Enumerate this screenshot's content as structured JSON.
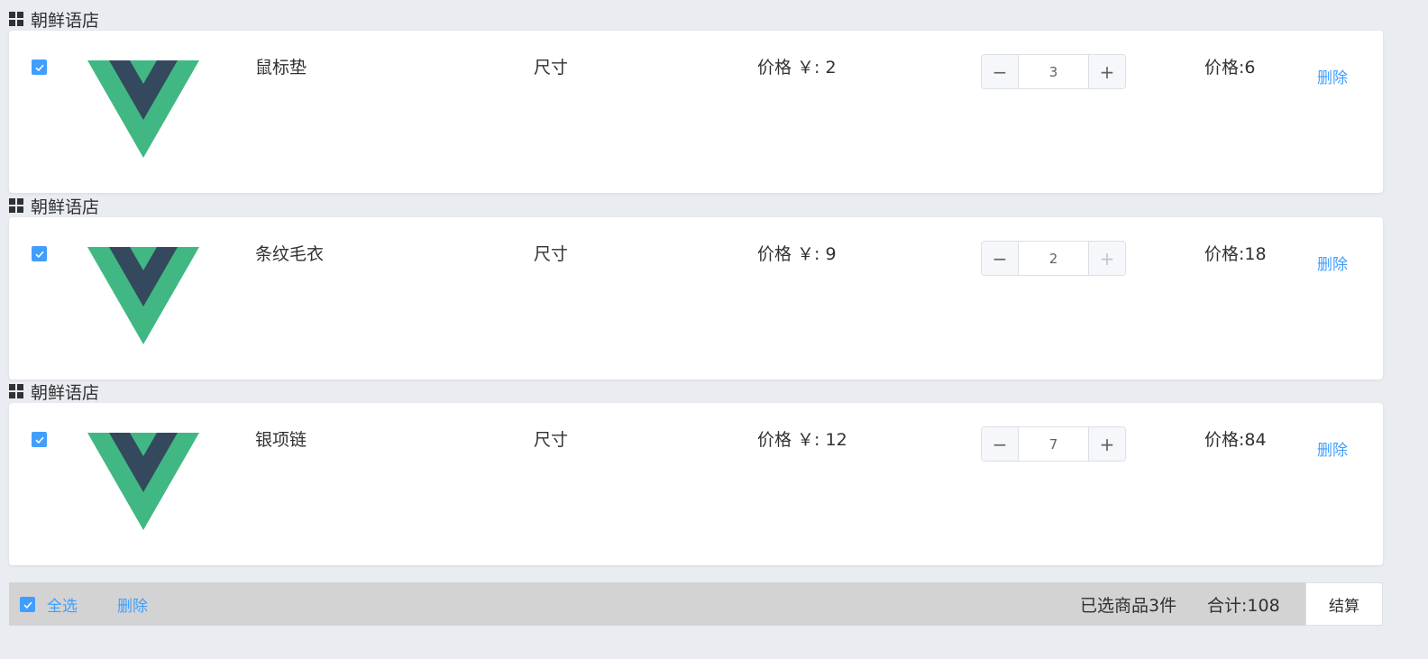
{
  "shops": [
    {
      "shop_name": "朝鲜语店",
      "item": {
        "checked": true,
        "name": "鼠标垫",
        "spec_label": "尺寸",
        "unit_price": "价格 ￥: 2",
        "quantity": "3",
        "minus_label": "−",
        "plus_label": "+",
        "subtotal": "价格:6",
        "delete_label": "删除"
      }
    },
    {
      "shop_name": "朝鲜语店",
      "item": {
        "checked": true,
        "name": "条纹毛衣",
        "spec_label": "尺寸",
        "unit_price": "价格 ￥: 9",
        "quantity": "2",
        "minus_label": "−",
        "plus_label": "+",
        "subtotal": "价格:18",
        "delete_label": "删除"
      }
    },
    {
      "shop_name": "朝鲜语店",
      "item": {
        "checked": true,
        "name": "银项链",
        "spec_label": "尺寸",
        "unit_price": "价格 ￥: 12",
        "quantity": "7",
        "minus_label": "−",
        "plus_label": "+",
        "subtotal": "价格:84",
        "delete_label": "删除"
      }
    }
  ],
  "footer": {
    "select_all_checked": true,
    "select_all_label": "全选",
    "delete_label": "删除",
    "selected_count": "已选商品3件",
    "total": "合计:108",
    "checkout_label": "结算"
  },
  "colors": {
    "accent": "#409eff",
    "logo_green": "#41b883",
    "logo_dark": "#34495e",
    "page_bg": "#e9edf1",
    "footer_bg": "#d3d3d3"
  },
  "icons": {
    "shop_icon": "grid-icon",
    "checkbox_icon": "check-icon",
    "product_image": "vue-logo"
  }
}
